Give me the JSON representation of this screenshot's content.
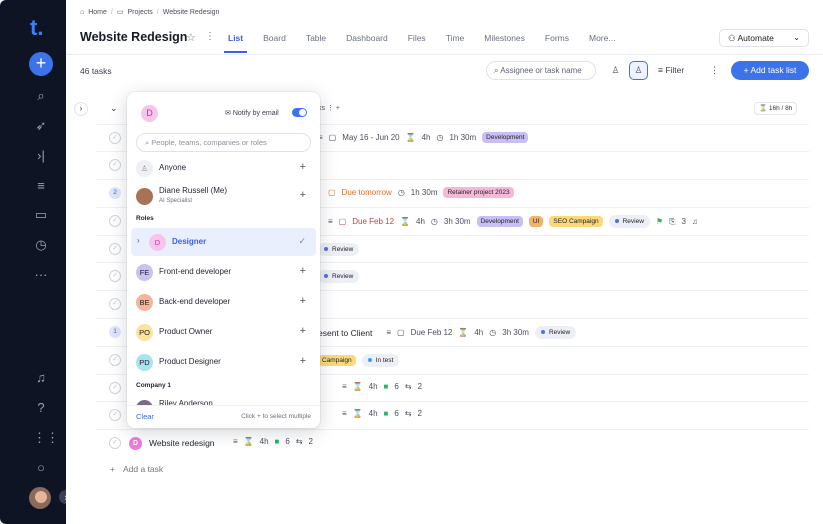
{
  "sidebar": {
    "logo": "t.",
    "add": "+",
    "icons": [
      "search-icon",
      "rocket-icon",
      "collapse-icon",
      "list-check-icon",
      "folder-icon",
      "stopwatch-icon",
      "more-icon",
      "bell-icon",
      "help-icon",
      "apps-icon",
      "chat-icon"
    ]
  },
  "breadcrumb": {
    "home": "Home",
    "projects": "Projects",
    "current": "Website Redesign"
  },
  "header": {
    "title": "Website Redesign",
    "tabs": [
      "List",
      "Board",
      "Table",
      "Dashboard",
      "Files",
      "Time",
      "Milestones",
      "Forms",
      "More..."
    ],
    "active_tab": "List",
    "automate": "Automate"
  },
  "toolbar": {
    "task_count": "46 tasks",
    "search_placeholder": "Assignee or task name",
    "filter": "Filter",
    "add_task_list": "Add task list"
  },
  "group": {
    "tail": "ks",
    "time": "16h / 8h"
  },
  "rows": [
    {
      "date": "May 16 - Jun 20",
      "est": "4h",
      "logged": "1h 30m",
      "tags": [
        "Development"
      ]
    },
    {},
    {
      "num": "2",
      "due": "Due tomorrow",
      "logged": "1h 30m",
      "tags": [
        "Retainer project 2023"
      ]
    },
    {
      "due": "Due Feb 12",
      "est": "4h",
      "logged": "3h 30m",
      "tags": [
        "Development",
        "UI",
        "SEO Campaign"
      ],
      "status": "Review",
      "attach": "3"
    },
    {
      "status": "Review"
    },
    {
      "status": "Review"
    },
    {},
    {
      "num": "1",
      "name": "esent to Client",
      "due": "Due Feb 12",
      "est": "4h",
      "logged": "3h 30m",
      "status": "Review"
    },
    {
      "tag": "Campaign",
      "status": "In test"
    },
    {
      "est": "4h",
      "comments": "6",
      "subtasks": "2"
    },
    {
      "est": "4h",
      "comments": "6",
      "subtasks": "2"
    },
    {
      "name": "Website redesign",
      "badge": "D",
      "est": "4h",
      "comments": "6",
      "subtasks": "2"
    }
  ],
  "add_task": "Add a task",
  "dropdown": {
    "avatar": "D",
    "notify": "Notify by email",
    "search_placeholder": "People, teams, companies or roles",
    "anyone": "Anyone",
    "user": {
      "name": "Diane Russell (Me)",
      "role": "AI Specialist"
    },
    "roles_heading": "Roles",
    "roles": [
      {
        "initials": "D",
        "name": "Designer",
        "color": "#f7c4ec"
      },
      {
        "initials": "FE",
        "name": "Front-end developer",
        "color": "#c8c2f5"
      },
      {
        "initials": "BE",
        "name": "Back-end developer",
        "color": "#f6b49a"
      },
      {
        "initials": "PO",
        "name": "Product Owner",
        "color": "#fbe39a"
      },
      {
        "initials": "PD",
        "name": "Product Designer",
        "color": "#a8e3ee"
      }
    ],
    "company_heading": "Company 1",
    "company_user": "Riley Anderson",
    "clear": "Clear",
    "hint": "Click + to select multiple"
  }
}
